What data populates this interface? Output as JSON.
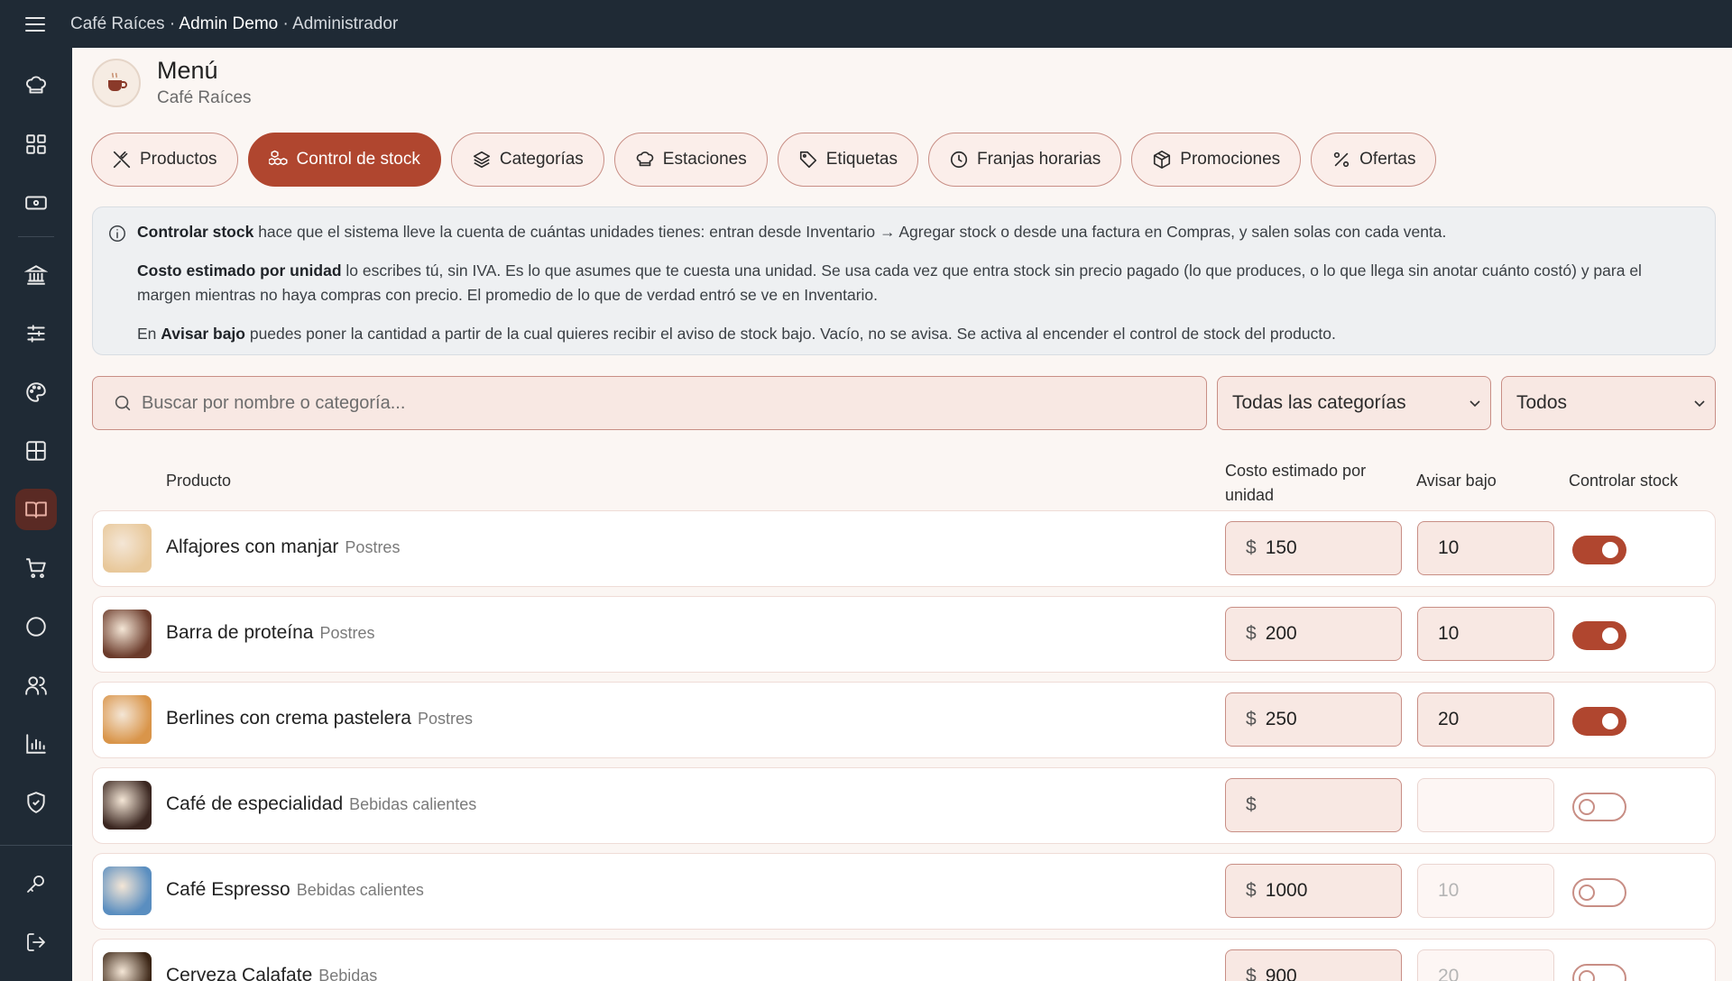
{
  "topbar": {
    "app_name": "Café Raíces",
    "separator": "·",
    "user": "Admin Demo",
    "role": "Administrador"
  },
  "sidebar": {
    "icons": [
      "chef-hat-icon",
      "grid-icon",
      "ticket-icon",
      "bank-icon",
      "sliders-icon",
      "palette-icon",
      "table-grid-icon",
      "book-icon",
      "cart-icon",
      "circle-icon",
      "users-icon",
      "bar-chart-icon",
      "shield-check-icon",
      "key-icon",
      "logout-icon"
    ],
    "active": "book-icon"
  },
  "header": {
    "title": "Menú",
    "subtitle": "Café Raíces"
  },
  "tabs": [
    {
      "label": "Productos",
      "icon": "utensils-cross-icon"
    },
    {
      "label": "Control de stock",
      "icon": "boxes-icon",
      "active": true
    },
    {
      "label": "Categorías",
      "icon": "layers-icon"
    },
    {
      "label": "Estaciones",
      "icon": "chef-hat-icon"
    },
    {
      "label": "Etiquetas",
      "icon": "tag-icon"
    },
    {
      "label": "Franjas horarias",
      "icon": "clock-icon"
    },
    {
      "label": "Promociones",
      "icon": "package-icon"
    },
    {
      "label": "Ofertas",
      "icon": "percent-icon"
    }
  ],
  "info": {
    "p1_bold": "Controlar stock",
    "p1_text": " hace que el sistema lleve la cuenta de cuántas unidades tienes: entran desde Inventario → Agregar stock o desde una factura en Compras, y salen solas con cada venta.",
    "p2_bold": "Costo estimado por unidad",
    "p2_text": " lo escribes tú, sin IVA. Es lo que asumes que te cuesta una unidad. Se usa cada vez que entra stock sin precio pagado (lo que produces, o lo que llega sin anotar cuánto costó) y para el margen mientras no haya compras con precio. El promedio de lo que de verdad entró se ve en Inventario.",
    "p3_prefix": "En ",
    "p3_bold": "Avisar bajo",
    "p3_text": " puedes poner la cantidad a partir de la cual quieres recibir el aviso de stock bajo. Vacío, no se avisa. Se activa al encender el control de stock del producto."
  },
  "filters": {
    "search_placeholder": "Buscar por nombre o categoría...",
    "category_select": "Todas las categorías",
    "status_select": "Todos"
  },
  "table": {
    "headers": {
      "product": "Producto",
      "cost": "Costo estimado por unidad",
      "low": "Avisar bajo",
      "control": "Controlar stock"
    },
    "currency": "$",
    "rows": [
      {
        "name": "Alfajores con manjar",
        "category": "Postres",
        "cost": "150",
        "low": "10",
        "low_enabled": true,
        "control": true,
        "thumb_color": "#e8c89a"
      },
      {
        "name": "Barra de proteína",
        "category": "Postres",
        "cost": "200",
        "low": "10",
        "low_enabled": true,
        "control": true,
        "thumb_color": "#6a3a2a"
      },
      {
        "name": "Berlines con crema pastelera",
        "category": "Postres",
        "cost": "250",
        "low": "20",
        "low_enabled": true,
        "control": true,
        "thumb_color": "#d9954a"
      },
      {
        "name": "Café de especialidad",
        "category": "Bebidas calientes",
        "cost": "",
        "low": "",
        "low_enabled": false,
        "control": false,
        "thumb_color": "#3a2620"
      },
      {
        "name": "Café Espresso",
        "category": "Bebidas calientes",
        "cost": "1000",
        "low": "10",
        "low_enabled": false,
        "control": false,
        "thumb_color": "#5a8ec0"
      },
      {
        "name": "Cerveza Calafate",
        "category": "Bebidas",
        "cost": "900",
        "low": "20",
        "low_enabled": false,
        "control": false,
        "thumb_color": "#3a2414"
      }
    ]
  }
}
